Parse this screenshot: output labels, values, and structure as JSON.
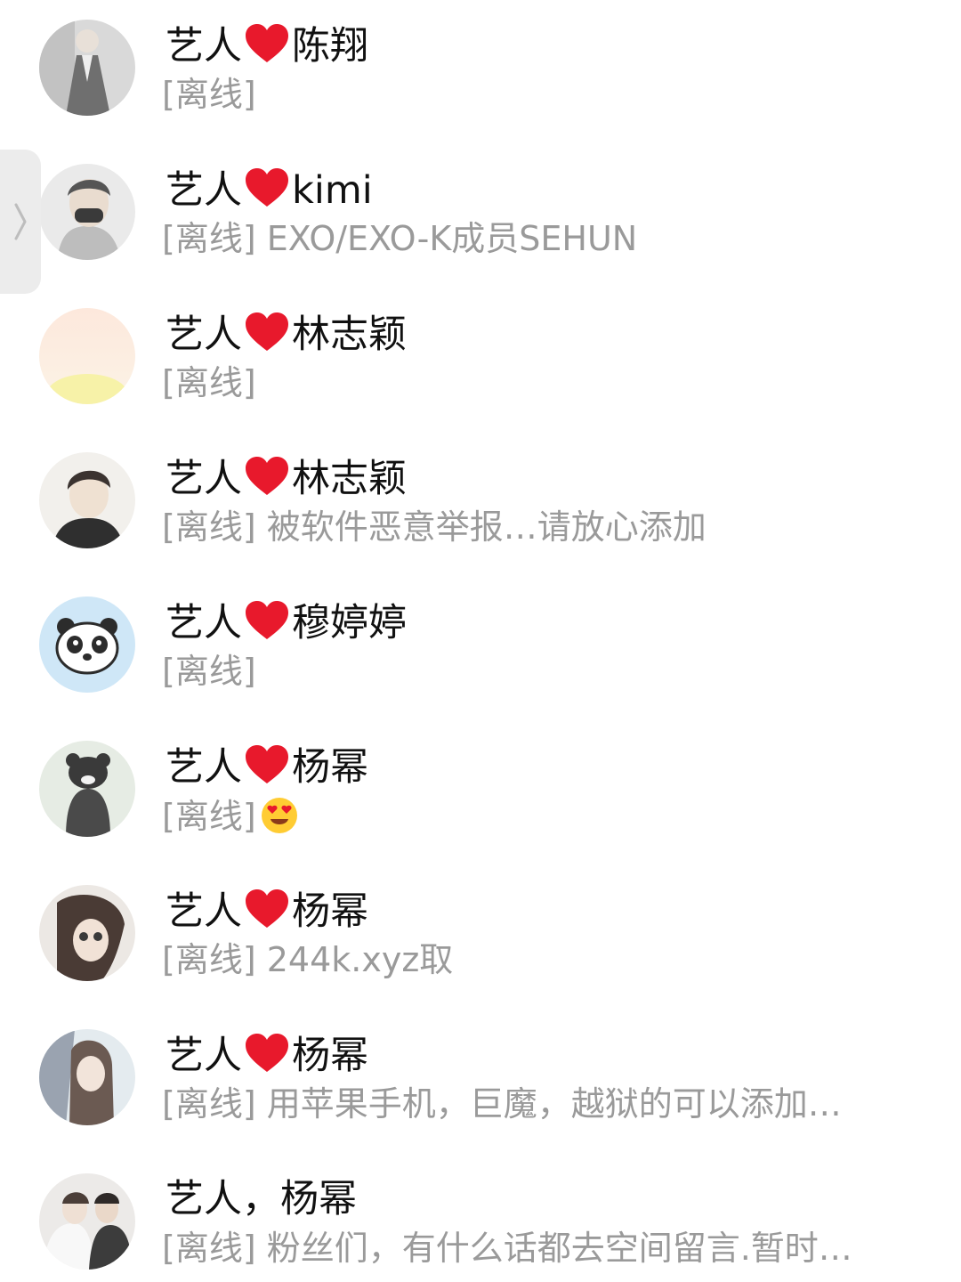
{
  "contacts": [
    {
      "name": "艺人❤陈翔",
      "prefix": "艺人",
      "suffix": "陈翔",
      "status": "[离线]",
      "avatar": "person-suit-avatar"
    },
    {
      "name": "艺人❤kimi",
      "prefix": "艺人",
      "suffix": "kimi",
      "status": "[离线] EXO/EXO-K成员SEHUN",
      "avatar": "person-mask-avatar"
    },
    {
      "name": "艺人❤林志颖",
      "prefix": "艺人",
      "suffix": "林志颖",
      "status": "[离线]",
      "avatar": "sunrise-avatar"
    },
    {
      "name": "艺人❤林志颖",
      "prefix": "艺人",
      "suffix": "林志颖",
      "status": "[离线] 被软件恶意举报…请放心添加",
      "avatar": "young-man-avatar"
    },
    {
      "name": "艺人❤穆婷婷",
      "prefix": "艺人",
      "suffix": "穆婷婷",
      "status": "[离线]",
      "avatar": "panda-avatar"
    },
    {
      "name": "艺人❤杨幂",
      "prefix": "艺人",
      "suffix": "杨幂",
      "status": "[离线]",
      "status_emoji": "heart-eyes-emoji",
      "avatar": "bear-mascot-avatar"
    },
    {
      "name": "艺人❤杨幂",
      "prefix": "艺人",
      "suffix": "杨幂",
      "status": "[离线] 244k.xyz取",
      "avatar": "woman-selfie-avatar"
    },
    {
      "name": "艺人❤杨幂",
      "prefix": "艺人",
      "suffix": "杨幂",
      "status": "[离线] 用苹果手机，巨魔，越狱的可以添加…",
      "avatar": "woman-portrait-avatar"
    },
    {
      "name": "艺人，杨幂",
      "prefix": "艺人，杨幂",
      "suffix": "",
      "status": "[离线] 粉丝们，有什么话都去空间留言.暂时…",
      "avatar": "wedding-couple-avatar"
    }
  ],
  "side_handle": {
    "icon": "chevron-right-icon"
  },
  "colors": {
    "name_text": "#111111",
    "status_text": "#9a9a9a",
    "heart": "#e8192c",
    "handle_bg": "#ececec"
  }
}
